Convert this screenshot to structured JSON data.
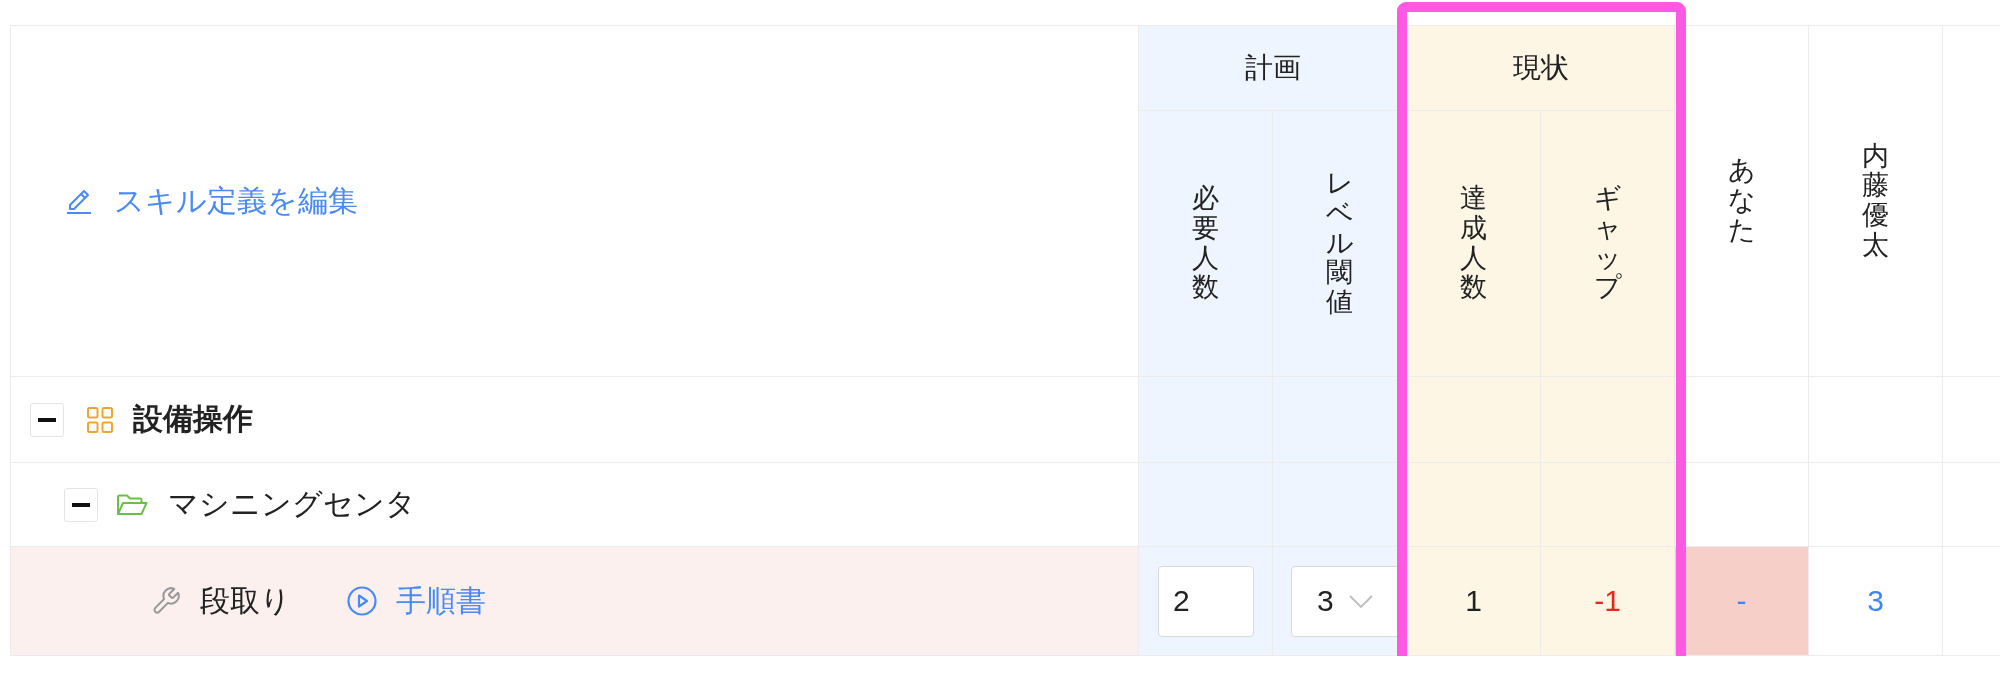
{
  "edit_link": {
    "label": "スキル定義を編集"
  },
  "column_groups": [
    {
      "label": "計画",
      "color": "#eef5fe",
      "highlighted": false,
      "columns": [
        {
          "kind": "required",
          "label": "必要人数"
        },
        {
          "kind": "threshold",
          "label": "レベル閾値"
        }
      ]
    },
    {
      "label": "現状",
      "color": "#fdf6e4",
      "highlighted": true,
      "columns": [
        {
          "kind": "achieved",
          "label": "達成人数"
        },
        {
          "kind": "gap",
          "label": "ギャップ"
        }
      ]
    }
  ],
  "members": [
    {
      "name": "あなた"
    },
    {
      "name": "内藤優太"
    }
  ],
  "tree": [
    {
      "kind": "category",
      "label": "設備操作",
      "expanded": true,
      "children": [
        {
          "kind": "group",
          "label": "マシニングセンタ",
          "expanded": true,
          "children": [
            {
              "kind": "skill",
              "label": "段取り",
              "manual_link": "手順書",
              "highlighted": true,
              "required": "2",
              "threshold": "3",
              "achieved": "1",
              "gap": "-1",
              "gap_negative": true,
              "scores": [
                {
                  "value": "-",
                  "short": true
                },
                {
                  "value": "3",
                  "short": false
                }
              ]
            }
          ]
        }
      ]
    }
  ]
}
